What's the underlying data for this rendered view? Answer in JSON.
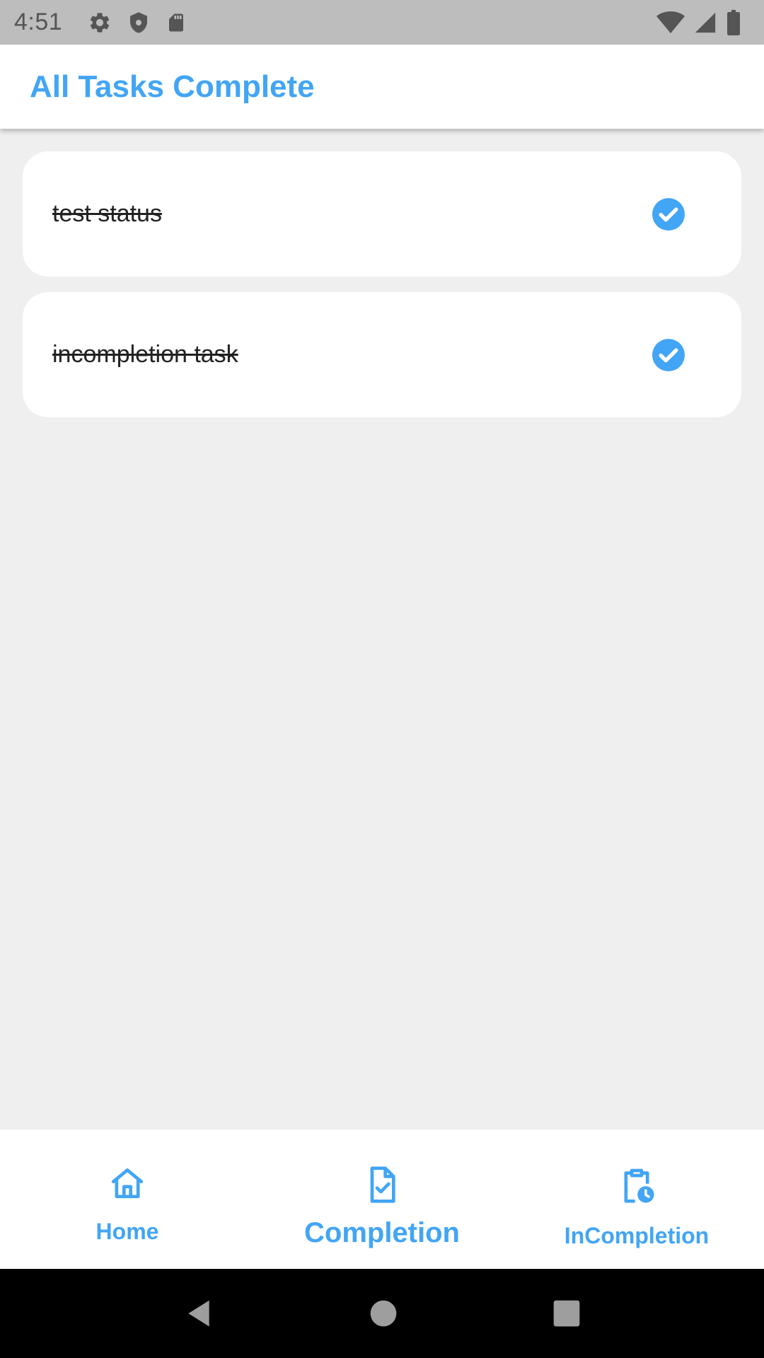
{
  "status_bar": {
    "time": "4:51",
    "left_icons": [
      "gear-icon",
      "shield-icon",
      "sd-card-icon"
    ],
    "right_icons": [
      "wifi-icon",
      "signal-icon",
      "battery-icon"
    ]
  },
  "app_bar": {
    "title": "All Tasks Complete"
  },
  "tasks": [
    {
      "label": "test status",
      "completed": true
    },
    {
      "label": "incompletion task",
      "completed": true
    }
  ],
  "bottom_nav": {
    "items": [
      {
        "label": "Home",
        "icon": "home-icon",
        "active": false
      },
      {
        "label": "Completion",
        "icon": "file-check-icon",
        "active": true
      },
      {
        "label": "InCompletion",
        "icon": "clipboard-clock-icon",
        "active": false
      }
    ]
  },
  "colors": {
    "accent": "#42a5f5",
    "background": "#efefef",
    "card": "#ffffff",
    "status_bar": "#bdbdbd"
  }
}
